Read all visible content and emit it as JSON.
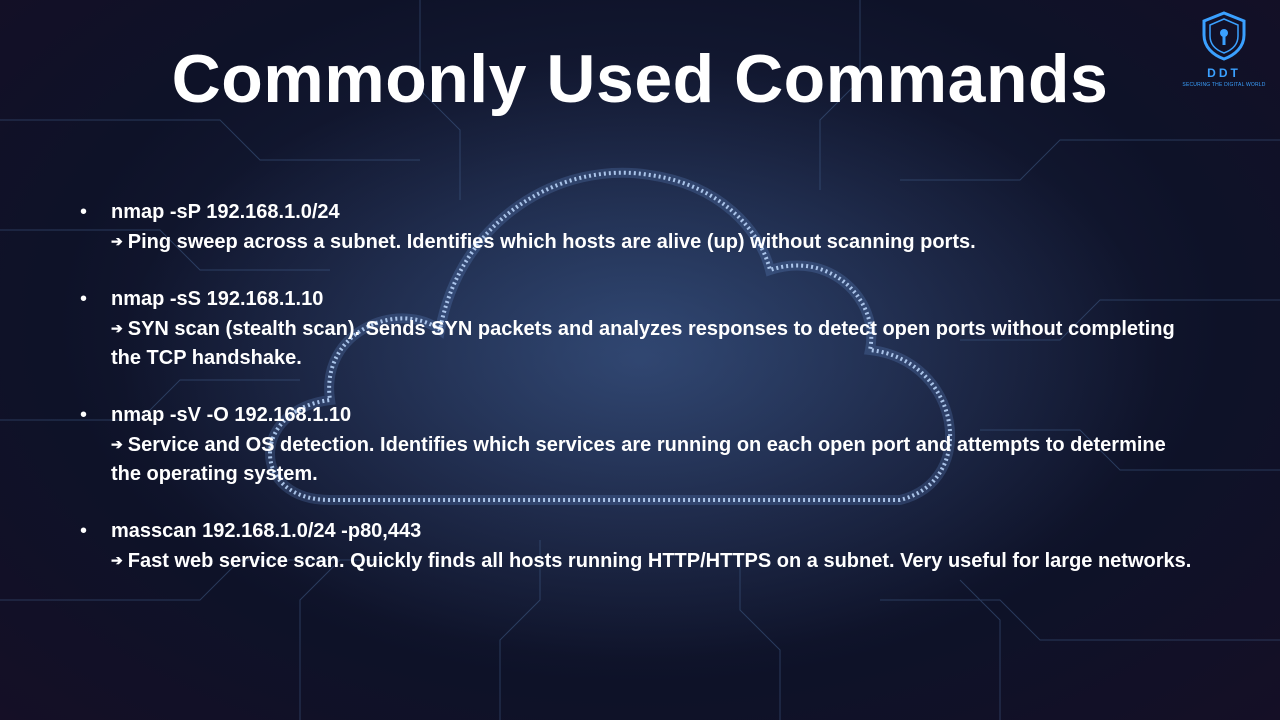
{
  "slide": {
    "title": "Commonly Used Commands",
    "logo": {
      "text": "DDT",
      "tagline": "SECURING THE DIGITAL WORLD",
      "icon": "shield-keyhole-icon"
    },
    "bullet_glyph": "•",
    "arrow_glyph": "➔",
    "items": [
      {
        "command": "nmap -sP 192.168.1.0/24",
        "description": "Ping sweep across a subnet. Identifies which hosts are alive (up) without scanning ports."
      },
      {
        "command": "nmap -sS 192.168.1.10",
        "description": "SYN scan (stealth scan). Sends SYN packets and analyzes responses to detect open ports without completing the TCP handshake."
      },
      {
        "command": "nmap -sV -O 192.168.1.10",
        "description": "Service and OS detection. Identifies which services are running on each open port and attempts to determine the operating system."
      },
      {
        "command": "masscan 192.168.1.0/24 -p80,443",
        "description": "Fast web service scan. Quickly finds all hosts running HTTP/HTTPS on a subnet. Very useful for large networks."
      }
    ]
  },
  "colors": {
    "background": "#141b35",
    "text": "#ffffff",
    "accent": "#3aa0ff",
    "cloud_glow": "#b8d8ff"
  }
}
